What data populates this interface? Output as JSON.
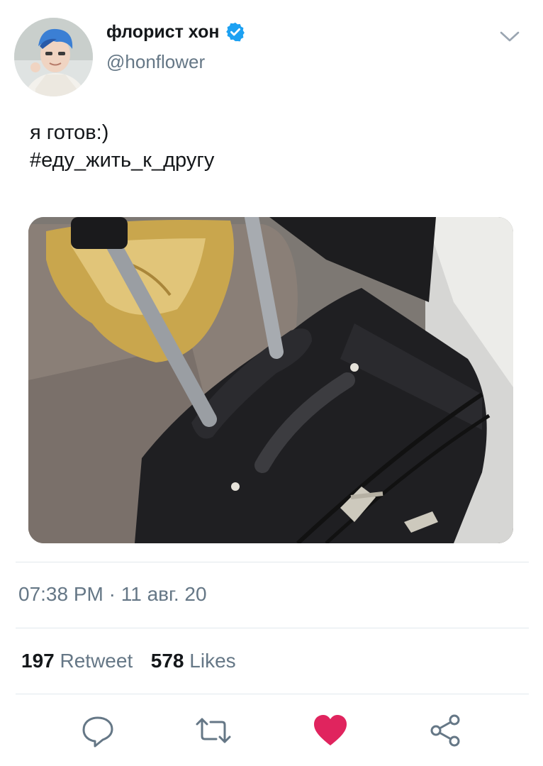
{
  "author": {
    "display_name": "флорист хон",
    "handle": "@honflower",
    "verified": true,
    "verified_color": "#1da1f2"
  },
  "tweet": {
    "text_line1": "я готов:)",
    "text_line2": "#еду_жить_к_другу"
  },
  "meta": {
    "timestamp": "07:38 PM · 11 авг. 20"
  },
  "stats": {
    "retweets_count": "197",
    "retweets_label": "Retweet",
    "likes_count": "578",
    "likes_label": "Likes"
  },
  "actions": {
    "reply_icon": "reply-icon",
    "retweet_icon": "retweet-icon",
    "like_icon": "heart-icon",
    "like_color": "#e0245e",
    "share_icon": "share-icon"
  },
  "colors": {
    "text_primary": "#14171a",
    "text_secondary": "#657786",
    "divider": "#e1e8ed"
  }
}
